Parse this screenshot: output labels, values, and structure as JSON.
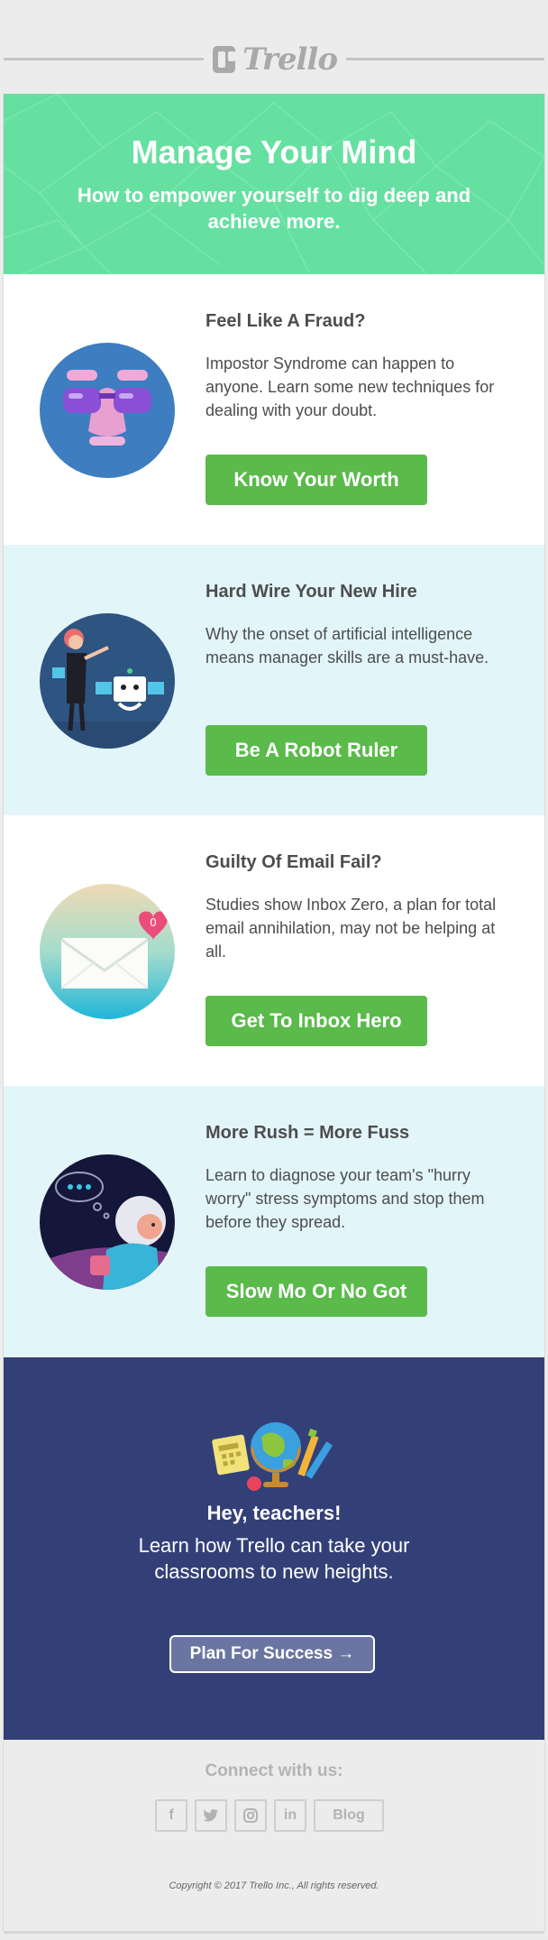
{
  "brand": {
    "logo_text": "Trello"
  },
  "hero": {
    "title": "Manage Your Mind",
    "subtitle": "How to empower yourself to dig deep and achieve more."
  },
  "articles": [
    {
      "title": "Feel Like A Fraud?",
      "body": "Impostor Syndrome can happen to anyone. Learn some new techniques for dealing with your doubt.",
      "button": "Know Your Worth",
      "icon": "disguise-glasses-icon"
    },
    {
      "title": "Hard Wire Your New Hire",
      "body": "Why the onset of artificial intelligence means manager skills are a must-have.",
      "button": "Be A Robot Ruler",
      "icon": "manager-robot-icon"
    },
    {
      "title": "Guilty Of Email Fail?",
      "body": "Studies show Inbox Zero, a plan for total email annihilation, may not be helping at all.",
      "button": "Get To Inbox Hero",
      "icon": "envelope-heart-icon"
    },
    {
      "title": "More Rush = More Fuss",
      "body": "Learn to diagnose your team's \"hurry worry\" stress symptoms and stop them before they spread.",
      "button": "Slow Mo Or No Got",
      "icon": "worried-person-icon"
    }
  ],
  "teachers": {
    "heading": "Hey, teachers!",
    "body": "Learn how Trello can take your classrooms to new heights.",
    "button": "Plan For Success →"
  },
  "footer": {
    "connect": "Connect with us:",
    "socials": [
      "f",
      "twitter",
      "instagram",
      "in",
      "Blog"
    ],
    "copyright": "Copyright © 2017 Trello Inc., All rights reserved."
  },
  "colors": {
    "hero_green": "#66e0a1",
    "button_green": "#5aba4a",
    "light_blue_bg": "#e2f5f9",
    "navy": "#334078",
    "footer_gray": "#ececec"
  }
}
